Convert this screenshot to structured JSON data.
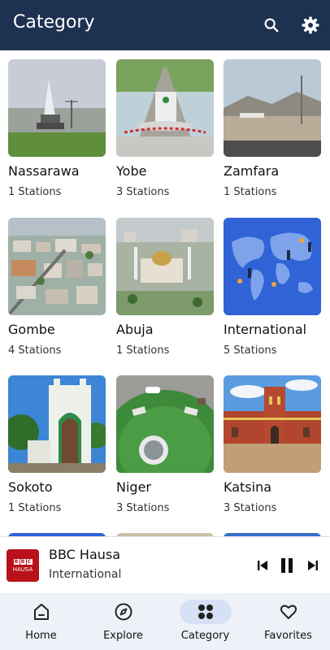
{
  "header": {
    "title": "Category",
    "actions": [
      "search-icon",
      "gear-icon"
    ]
  },
  "categories": [
    {
      "name": "Nassarawa",
      "stations": "1 Stations"
    },
    {
      "name": "Yobe",
      "stations": "3 Stations"
    },
    {
      "name": "Zamfara",
      "stations": "1 Stations"
    },
    {
      "name": "Gombe",
      "stations": "4 Stations"
    },
    {
      "name": "Abuja",
      "stations": "1 Stations"
    },
    {
      "name": "International",
      "stations": "5 Stations"
    },
    {
      "name": "Sokoto",
      "stations": "1 Stations"
    },
    {
      "name": "Niger",
      "stations": "3 Stations"
    },
    {
      "name": "Katsina",
      "stations": "3 Stations"
    }
  ],
  "player": {
    "logo_text": [
      "B",
      "B",
      "C"
    ],
    "logo_sub": "HAUSA",
    "title": "BBC Hausa",
    "subtitle": "International",
    "controls": [
      "skip-previous-icon",
      "pause-icon",
      "skip-next-icon"
    ]
  },
  "bottom_nav": {
    "items": [
      {
        "label": "Home",
        "icon": "home-icon",
        "active": false
      },
      {
        "label": "Explore",
        "icon": "compass-icon",
        "active": false
      },
      {
        "label": "Category",
        "icon": "grid-icon",
        "active": true
      },
      {
        "label": "Favorites",
        "icon": "heart-icon",
        "active": false
      }
    ]
  },
  "colors": {
    "appbar": "#1d3150",
    "nav_bg": "#eef2f8",
    "nav_active": "#d6e0f7",
    "logo": "#b8111a"
  }
}
